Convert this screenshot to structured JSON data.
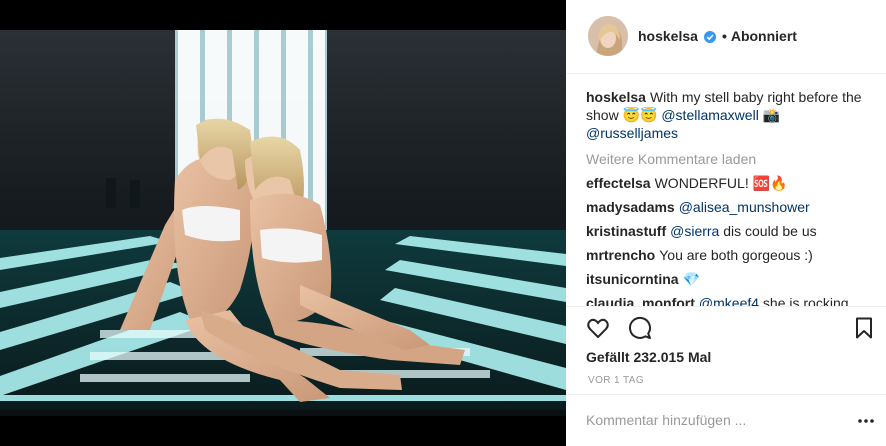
{
  "post": {
    "username": "hoskelsa",
    "separator": "•",
    "follow_status": "Abonniert",
    "verified_color": "#3897f0"
  },
  "caption": {
    "user": "hoskelsa",
    "text": "With my stell baby right before the show",
    "emoji": "😇😇",
    "mention1": "@stellamaxwell",
    "camera": "📸",
    "mention2": "@russelljames"
  },
  "load_more": "Weitere Kommentare laden",
  "comments": [
    {
      "user": "effectelsa",
      "text": "WONDERFUL! 🆘🔥"
    },
    {
      "user": "madysadams",
      "text": "",
      "mention": "@alisea_munshower"
    },
    {
      "user": "kristinastuff",
      "text": " dis could be us",
      "mention": "@sierra"
    },
    {
      "user": "mrtrencho",
      "text": "You are both gorgeous :)"
    },
    {
      "user": "itsunicorntina",
      "text": "💎"
    },
    {
      "user": "claudia_monfort",
      "text": " she is rocking",
      "mention": "@mkeef4"
    }
  ],
  "icons": {
    "like": "heart-outline-icon",
    "comment": "speech-bubble-icon",
    "save": "bookmark-icon",
    "more": "ellipsis-icon"
  },
  "likes_text": "Gefällt 232.015 Mal",
  "age_text": "VOR 1 TAG",
  "comment_input": {
    "placeholder": "Kommentar hinzufügen ..."
  }
}
